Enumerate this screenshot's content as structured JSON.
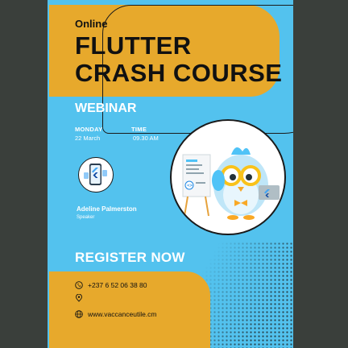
{
  "header": {
    "online": "Online",
    "title_line1": "FLUTTER",
    "title_line2": "CRASH COURSE"
  },
  "webinar": "WEBINAR",
  "schedule": {
    "day_label": "MONDAY",
    "day_value": "22 March",
    "time_label": "TIME",
    "time_value": "09.30 AM"
  },
  "speaker": {
    "name": "Adeline Palmerston",
    "role": "Speaker"
  },
  "cta": "REGISTER NOW",
  "contact": {
    "phone": "+237 6 52 06 38 80",
    "website": "www.vaccanceutile.cm"
  },
  "colors": {
    "accent_orange": "#e7a92c",
    "background_blue": "#53c2ee",
    "flutter_blue": "#2a9fe0"
  },
  "icons": [
    "phone-icon",
    "location-pin-icon",
    "globe-icon",
    "flutter-logo-icon"
  ]
}
